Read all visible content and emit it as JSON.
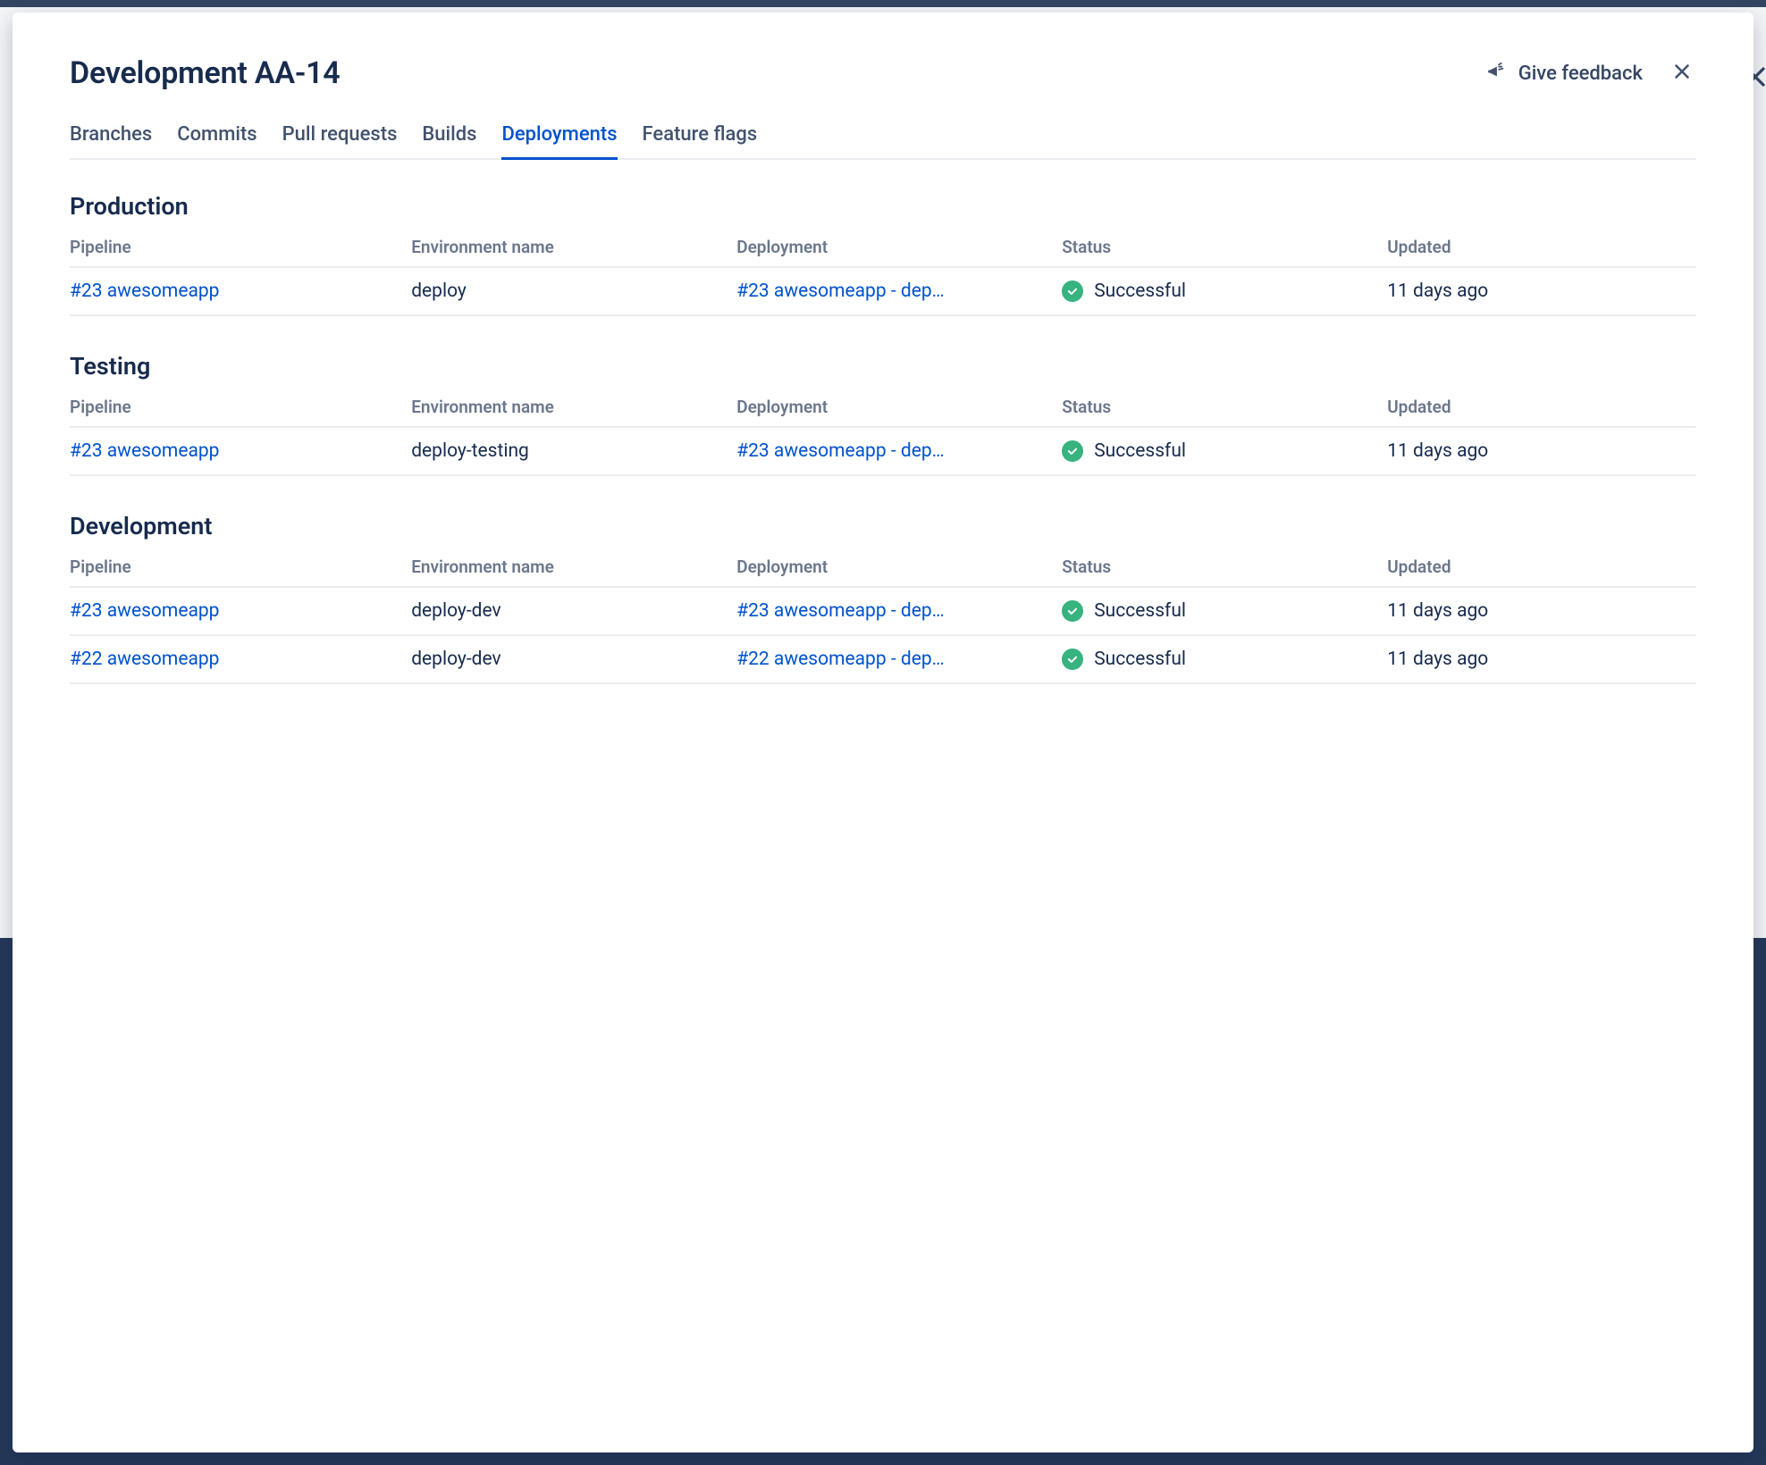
{
  "header": {
    "title": "Development AA-14",
    "feedback_label": "Give feedback"
  },
  "tabs": [
    {
      "label": "Branches"
    },
    {
      "label": "Commits"
    },
    {
      "label": "Pull requests"
    },
    {
      "label": "Builds"
    },
    {
      "label": "Deployments",
      "active": true
    },
    {
      "label": "Feature flags"
    }
  ],
  "columns": {
    "pipeline": "Pipeline",
    "env": "Environment name",
    "deployment": "Deployment",
    "status": "Status",
    "updated": "Updated"
  },
  "sections": [
    {
      "title": "Production",
      "rows": [
        {
          "pipeline": "#23 awesomeapp",
          "env": "deploy",
          "deployment": "#23 awesomeapp - dep…",
          "status": "Successful",
          "updated": "11 days ago"
        }
      ]
    },
    {
      "title": "Testing",
      "rows": [
        {
          "pipeline": "#23 awesomeapp",
          "env": "deploy-testing",
          "deployment": "#23 awesomeapp - dep…",
          "status": "Successful",
          "updated": "11 days ago"
        }
      ]
    },
    {
      "title": "Development",
      "rows": [
        {
          "pipeline": "#23 awesomeapp",
          "env": "deploy-dev",
          "deployment": "#23 awesomeapp - dep…",
          "status": "Successful",
          "updated": "11 days ago"
        },
        {
          "pipeline": "#22 awesomeapp",
          "env": "deploy-dev",
          "deployment": "#22 awesomeapp - dep…",
          "status": "Successful",
          "updated": "11 days ago"
        }
      ]
    }
  ]
}
